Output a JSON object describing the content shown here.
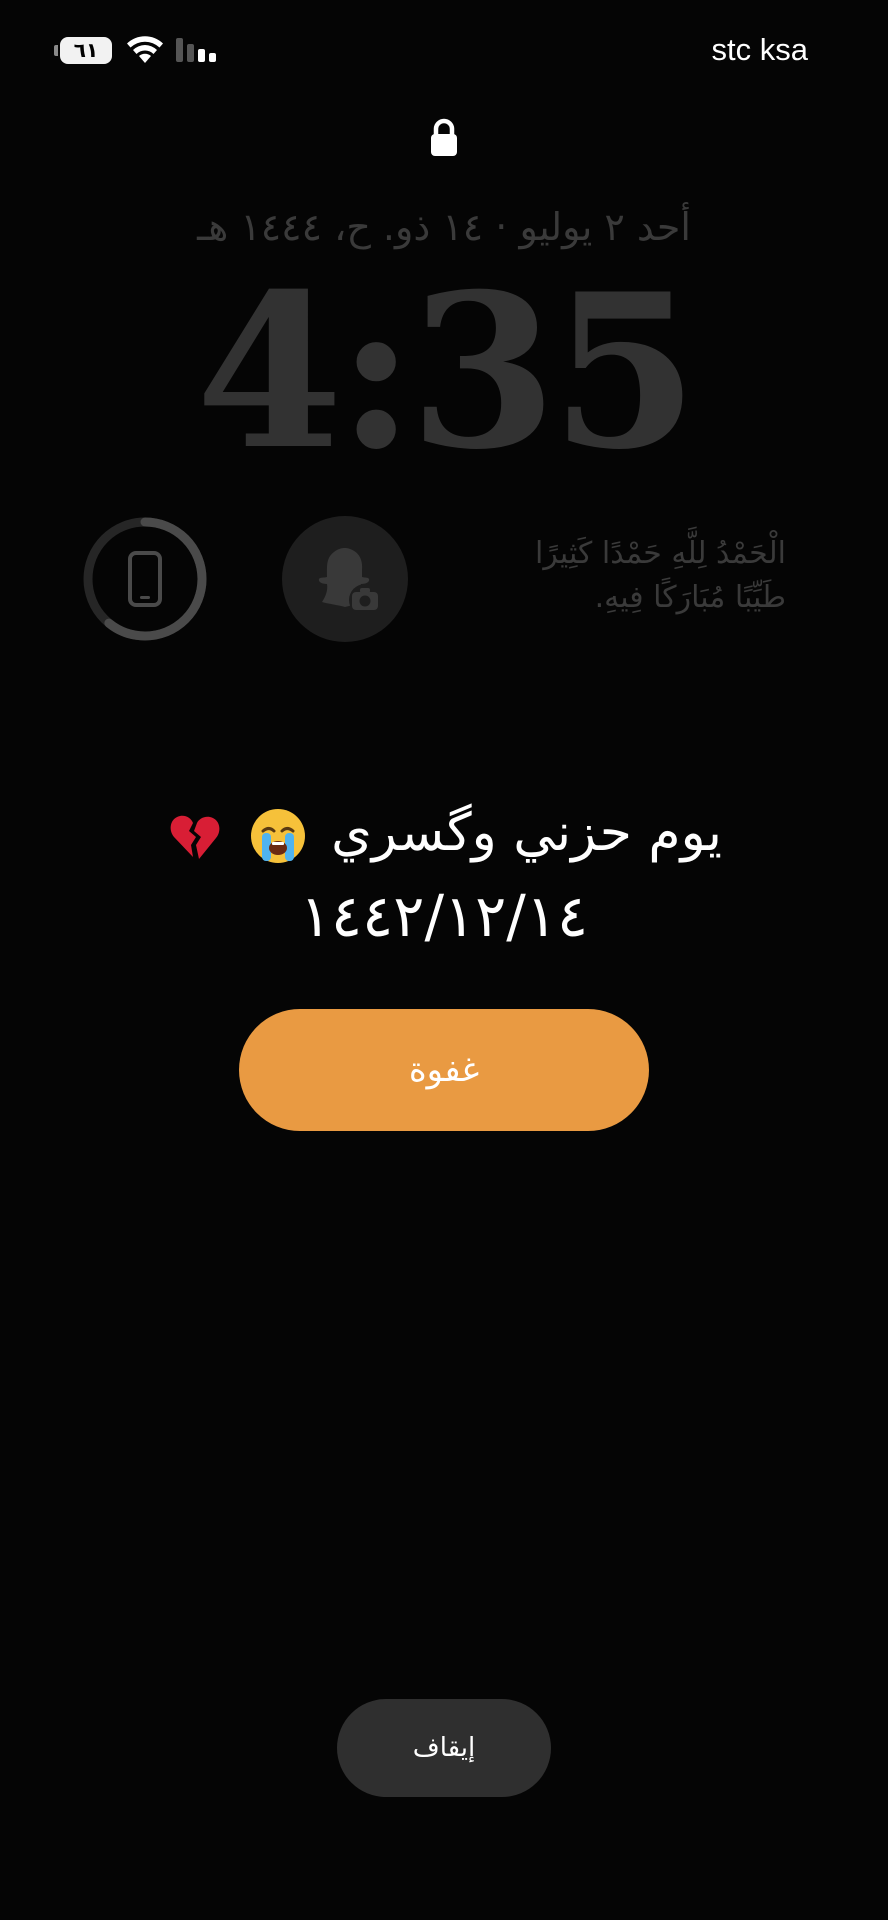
{
  "status_bar": {
    "battery_level": "٦١",
    "carrier": "stc ksa",
    "icons": [
      "battery-icon",
      "wifi-icon",
      "cellular-signal-icon"
    ]
  },
  "lock_screen": {
    "lock_icon": "lock-icon",
    "date": "أحد ٢ يوليو · ١٤ ذو. ح، ١٤٤٤ هـ",
    "time": "4:35",
    "widgets": {
      "battery_widget_icon": "phone-battery-icon",
      "snapchat_widget_icon": "snapchat-camera-icon",
      "quote_line1": "الْحَمْدُ لِلَّهِ حَمْدًا كَثِيرًا",
      "quote_line2": "طَيِّبًا مُبَارَكًا فِيهِ."
    }
  },
  "alarm": {
    "label": "يوم حزني وگسري",
    "emojis": [
      "crying-face-emoji",
      "broken-heart-emoji"
    ],
    "date": "١٤٤٢/١٢/١٤",
    "snooze_label": "غفوة",
    "stop_label": "إيقاف"
  },
  "colors": {
    "background": "#050505",
    "snooze": "#e99a42",
    "stop": "#2f2f2f",
    "dim_text": "#3a3a3a"
  }
}
